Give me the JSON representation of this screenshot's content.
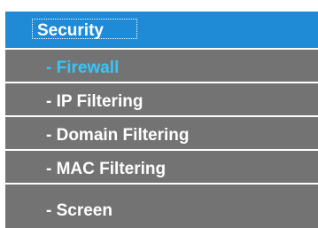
{
  "menu": {
    "section_title": "Security",
    "items": [
      {
        "label": "- Firewall",
        "active": true
      },
      {
        "label": "- IP Filtering",
        "active": false
      },
      {
        "label": "- Domain Filtering",
        "active": false
      },
      {
        "label": "- MAC Filtering",
        "active": false
      },
      {
        "label": "- Screen",
        "active": false
      }
    ]
  },
  "colors": {
    "header_bg": "#1f8ad6",
    "item_bg": "#737373",
    "item_text": "#ffffff",
    "active_text": "#33c7ff"
  }
}
